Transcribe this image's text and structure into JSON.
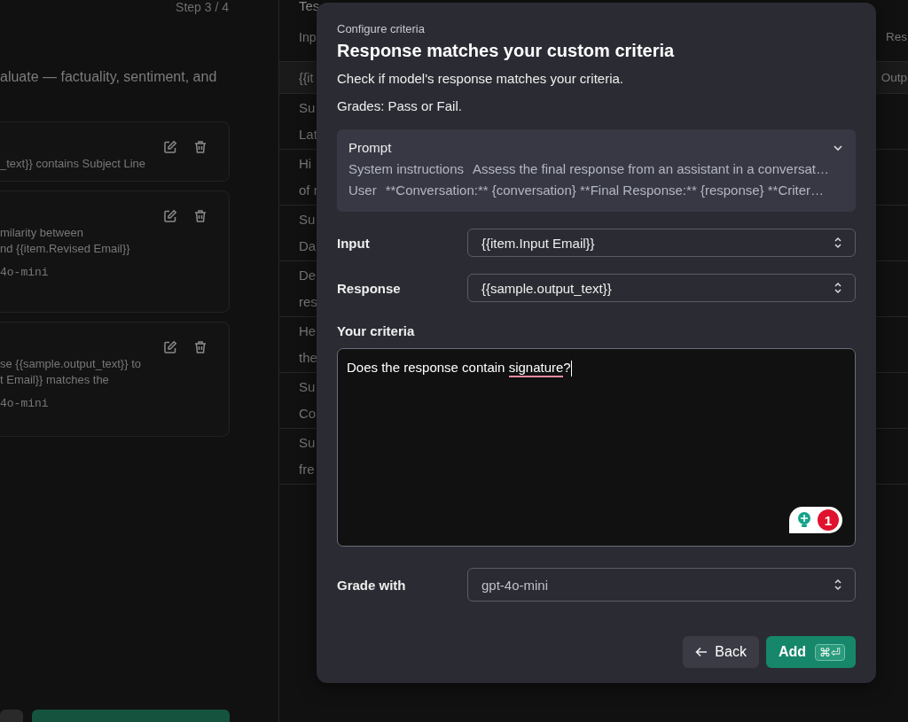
{
  "left_panel": {
    "step": "Step 3 / 4",
    "description": "aluate — factuality, sentiment, and",
    "criteria_cards": [
      {
        "lines": [
          "_text}} contains Subject Line"
        ]
      },
      {
        "lines": [
          "milarity between",
          "nd {{item.Revised Email}}"
        ],
        "model": "4o-mini"
      },
      {
        "lines": [
          "se {{sample.output_text}} to",
          "t Email}} matches the"
        ],
        "model": "4o-mini"
      }
    ]
  },
  "test_data": {
    "title": "Tes",
    "columns": [
      "Inp",
      "Res"
    ],
    "variables_row": [
      "{{it",
      "Outp"
    ],
    "rows": [
      [
        "Su",
        "Lat"
      ],
      [
        "Hi",
        "of r"
      ],
      [
        "Su",
        "Da"
      ],
      [
        "De",
        "res"
      ],
      [
        "He",
        "the"
      ],
      [
        "Su",
        "Co"
      ],
      [
        "Su",
        "fre"
      ]
    ]
  },
  "dialog": {
    "eyebrow": "Configure criteria",
    "title": "Response matches your custom criteria",
    "description": "Check if model's response matches your criteria.",
    "grades": "Grades: Pass or Fail.",
    "prompt": {
      "label": "Prompt",
      "expanded": false,
      "messages": [
        {
          "role": "System instructions",
          "text": "Assess the final response from an assistant in a conversat…"
        },
        {
          "role": "User",
          "text": "**Conversation:** {conversation} **Final Response:** {response} **Criter…"
        }
      ]
    },
    "fields": [
      {
        "label": "Input",
        "value": "{{item.Input Email}}"
      },
      {
        "label": "Response",
        "value": "{{sample.output_text}}"
      }
    ],
    "criteria": {
      "label": "Your criteria",
      "value_parts": [
        {
          "text": "Does the response contain ",
          "flagged": false
        },
        {
          "text": "signature",
          "flagged": true
        },
        {
          "text": "?",
          "flagged": false
        }
      ],
      "suggestion_count": "1"
    },
    "grader": {
      "label": "Grade with",
      "value": "gpt-4o-mini"
    },
    "buttons": [
      {
        "kind": "secondary",
        "label": "Back"
      },
      {
        "kind": "primary",
        "label": "Add",
        "shortcut": "⌘⏎"
      }
    ]
  }
}
